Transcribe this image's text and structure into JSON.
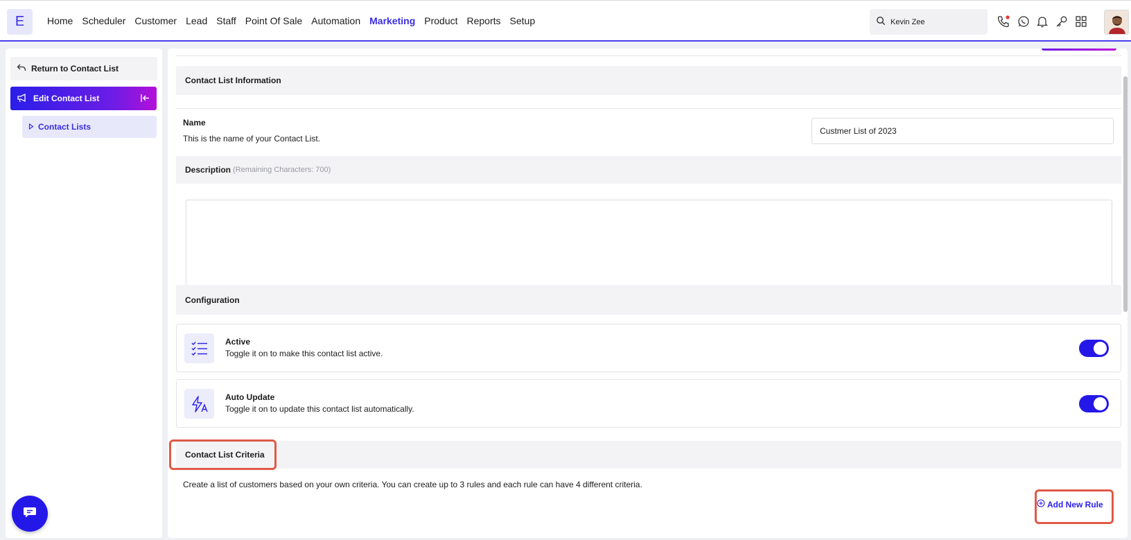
{
  "brand": {
    "logo_letter": "E",
    "accent": "#2418e8",
    "highlight": "#e05a45"
  },
  "nav": {
    "items": [
      "Home",
      "Scheduler",
      "Customer",
      "Lead",
      "Staff",
      "Point Of Sale",
      "Automation",
      "Marketing",
      "Product",
      "Reports",
      "Setup"
    ],
    "active": "Marketing"
  },
  "search": {
    "value": "Kevin Zee"
  },
  "toolbar_icons": [
    "phone-icon",
    "whatsapp-icon",
    "bell-icon",
    "key-icon",
    "grid-icon"
  ],
  "sidebar": {
    "return_label": "Return to Contact List",
    "edit_label": "Edit Contact List",
    "sub_item_label": "Contact Lists"
  },
  "main": {
    "info_header": "Contact List Information",
    "name_label": "Name",
    "name_help": "This is the name of your Contact List.",
    "name_value": "Custmer List of 2023",
    "description_label": "Description",
    "description_hint": "(Remaining Characters: 700)",
    "description_value": "",
    "config_header": "Configuration",
    "config_items": [
      {
        "title": "Active",
        "description": "Toggle it on to make this contact list active.",
        "enabled": true,
        "icon": "checklist-icon"
      },
      {
        "title": "Auto Update",
        "description": "Toggle it on to update this contact list automatically.",
        "enabled": true,
        "icon": "auto-flash-icon"
      }
    ],
    "criteria_header": "Contact List Criteria",
    "criteria_text": "Create a list of customers based on your own criteria. You can create up to 3 rules and each rule can have 4 different criteria.",
    "add_rule_label": "Add New Rule"
  }
}
